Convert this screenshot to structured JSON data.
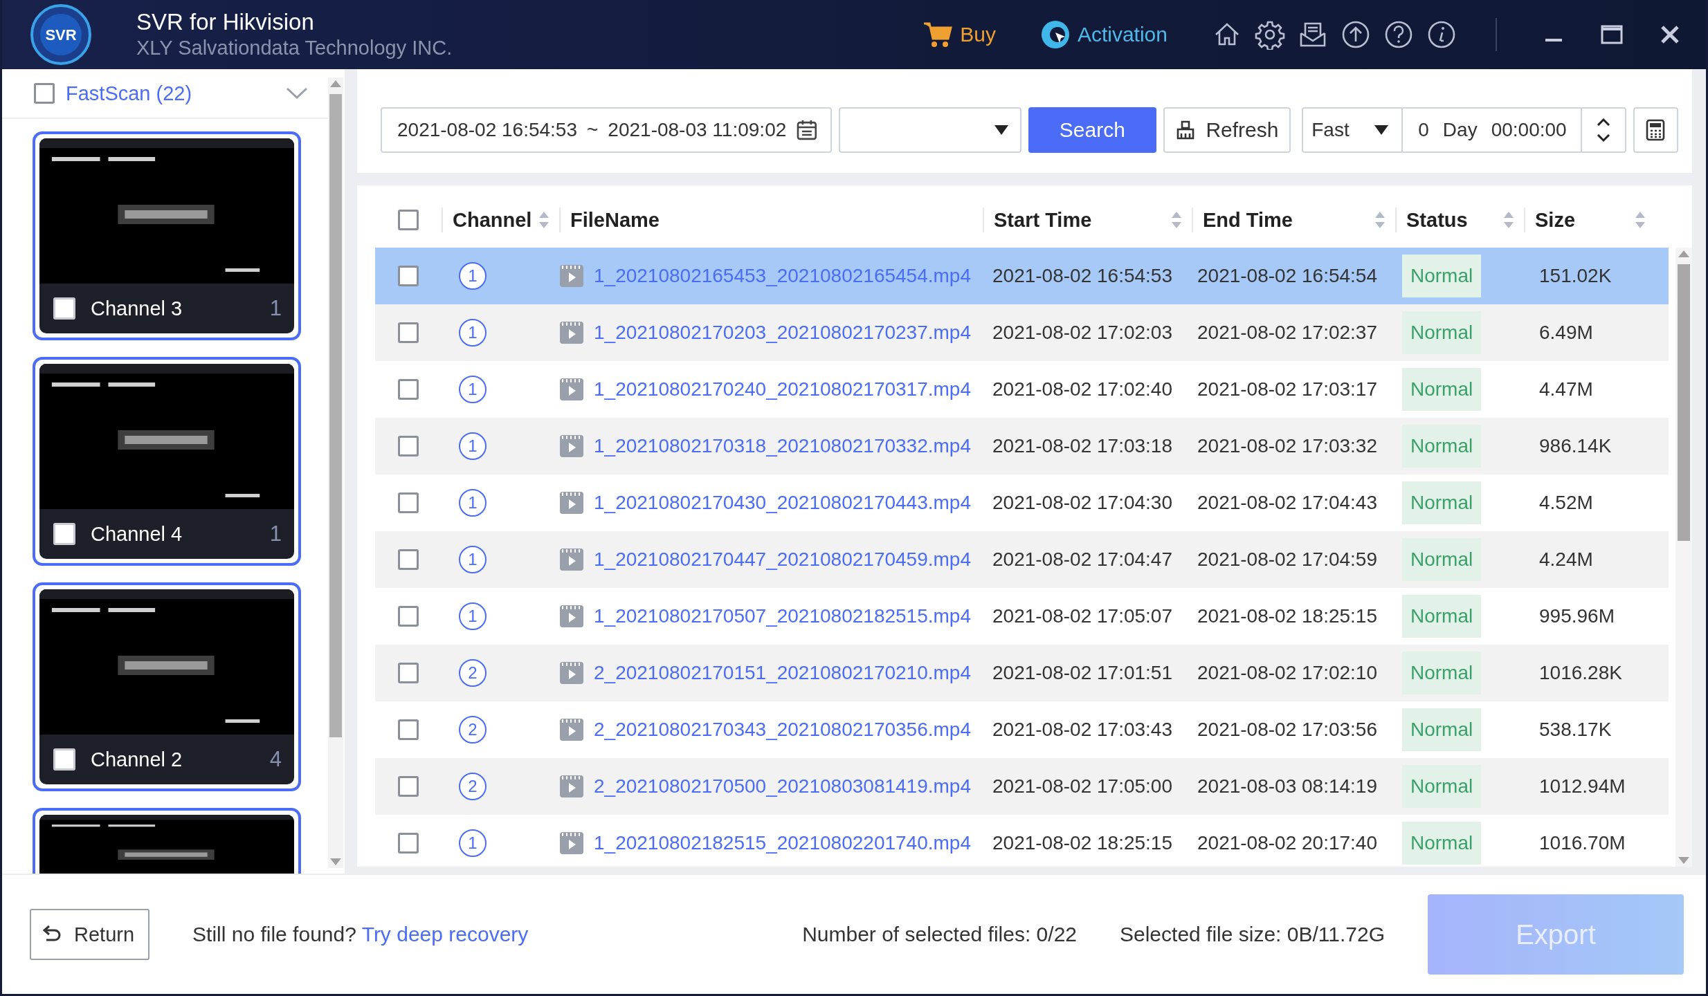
{
  "app": {
    "logo": "SVR",
    "title": "SVR for Hikvision",
    "subtitle": "XLY Salvationdata Technology INC."
  },
  "header_links": [
    {
      "kind": "buy",
      "label": "Buy"
    },
    {
      "kind": "activation",
      "label": "Activation"
    }
  ],
  "header_icons": [
    {
      "kind": "home"
    },
    {
      "kind": "settings"
    },
    {
      "kind": "feedback"
    },
    {
      "kind": "upload"
    },
    {
      "kind": "help"
    },
    {
      "kind": "info"
    }
  ],
  "window_controls": [
    {
      "kind": "minimize"
    },
    {
      "kind": "maximize"
    },
    {
      "kind": "close"
    }
  ],
  "sidebar": {
    "group": {
      "label": "FastScan (22)",
      "checked": false,
      "expanded": true
    },
    "channels": [
      {
        "name": "Channel 3",
        "count": "1",
        "checked": false
      },
      {
        "name": "Channel 4",
        "count": "1",
        "checked": false
      },
      {
        "name": "Channel 2",
        "count": "4",
        "checked": false
      },
      {
        "kind": "partial"
      }
    ]
  },
  "toolbar": {
    "date_range": {
      "start": "2021-08-02 16:54:53",
      "separator": "~",
      "end": "2021-08-03 11:09:02"
    },
    "search_button": "Search",
    "refresh_button": "Refresh",
    "mode": "Fast",
    "duration": {
      "days": "0",
      "day_label": "Day",
      "time": "00:00:00"
    }
  },
  "table": {
    "select_all": {
      "checked": false
    },
    "columns": [
      {
        "label": "Channel",
        "sortable": true
      },
      {
        "label": "FileName",
        "sortable": false
      },
      {
        "label": "Start Time",
        "sortable": true
      },
      {
        "label": "End Time",
        "sortable": true
      },
      {
        "label": "Status",
        "sortable": true
      },
      {
        "label": "Size",
        "sortable": true
      }
    ],
    "rows": [
      {
        "checked": false,
        "selected": true,
        "channel": "1",
        "filename": "1_20210802165453_20210802165454.mp4",
        "start": "2021-08-02 16:54:53",
        "end": "2021-08-02 16:54:54",
        "status": "Normal",
        "size": "151.02K"
      },
      {
        "checked": false,
        "selected": false,
        "channel": "1",
        "filename": "1_20210802170203_20210802170237.mp4",
        "start": "2021-08-02 17:02:03",
        "end": "2021-08-02 17:02:37",
        "status": "Normal",
        "size": "6.49M"
      },
      {
        "checked": false,
        "selected": false,
        "channel": "1",
        "filename": "1_20210802170240_20210802170317.mp4",
        "start": "2021-08-02 17:02:40",
        "end": "2021-08-02 17:03:17",
        "status": "Normal",
        "size": "4.47M"
      },
      {
        "checked": false,
        "selected": false,
        "channel": "1",
        "filename": "1_20210802170318_20210802170332.mp4",
        "start": "2021-08-02 17:03:18",
        "end": "2021-08-02 17:03:32",
        "status": "Normal",
        "size": "986.14K"
      },
      {
        "checked": false,
        "selected": false,
        "channel": "1",
        "filename": "1_20210802170430_20210802170443.mp4",
        "start": "2021-08-02 17:04:30",
        "end": "2021-08-02 17:04:43",
        "status": "Normal",
        "size": "4.52M"
      },
      {
        "checked": false,
        "selected": false,
        "channel": "1",
        "filename": "1_20210802170447_20210802170459.mp4",
        "start": "2021-08-02 17:04:47",
        "end": "2021-08-02 17:04:59",
        "status": "Normal",
        "size": "4.24M"
      },
      {
        "checked": false,
        "selected": false,
        "channel": "1",
        "filename": "1_20210802170507_20210802182515.mp4",
        "start": "2021-08-02 17:05:07",
        "end": "2021-08-02 18:25:15",
        "status": "Normal",
        "size": "995.96M"
      },
      {
        "checked": false,
        "selected": false,
        "channel": "2",
        "filename": "2_20210802170151_20210802170210.mp4",
        "start": "2021-08-02 17:01:51",
        "end": "2021-08-02 17:02:10",
        "status": "Normal",
        "size": "1016.28K"
      },
      {
        "checked": false,
        "selected": false,
        "channel": "2",
        "filename": "2_20210802170343_20210802170356.mp4",
        "start": "2021-08-02 17:03:43",
        "end": "2021-08-02 17:03:56",
        "status": "Normal",
        "size": "538.17K"
      },
      {
        "checked": false,
        "selected": false,
        "channel": "2",
        "filename": "2_20210802170500_20210803081419.mp4",
        "start": "2021-08-02 17:05:00",
        "end": "2021-08-03 08:14:19",
        "status": "Normal",
        "size": "1012.94M"
      },
      {
        "checked": false,
        "selected": false,
        "channel": "1",
        "filename": "1_20210802182515_20210802201740.mp4",
        "start": "2021-08-02 18:25:15",
        "end": "2021-08-02 20:17:40",
        "status": "Normal",
        "size": "1016.70M"
      }
    ]
  },
  "footer": {
    "return_button": "Return",
    "prompt": "Still no file found?",
    "link": "Try deep recovery",
    "selected_files": "Number of selected files: 0/22",
    "selected_size": "Selected file size: 0B/11.72G",
    "export": {
      "label": "Export",
      "disabled": true
    }
  }
}
